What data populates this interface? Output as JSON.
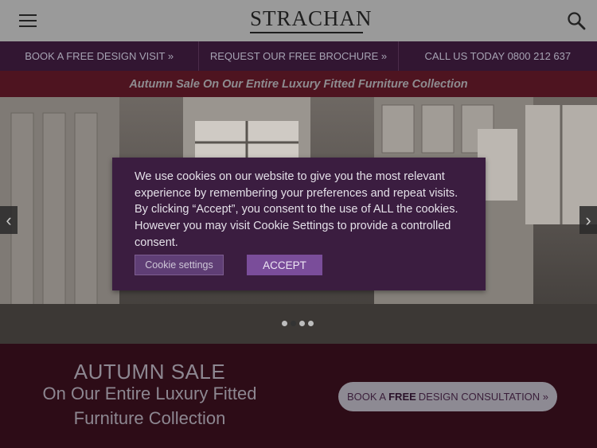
{
  "header": {
    "logo_text": "STRACHAN",
    "menu_icon": "hamburger-icon",
    "search_icon": "search-icon"
  },
  "nav": {
    "items": [
      {
        "label": "BOOK A FREE DESIGN VISIT »"
      },
      {
        "label": "REQUEST OUR FREE BROCHURE »"
      },
      {
        "label": "CALL US TODAY 0800 212 637"
      }
    ]
  },
  "promo": {
    "text": "Autumn Sale On Our Entire Luxury Fitted Furniture Collection"
  },
  "hero": {
    "prev_icon": "chevron-left-icon",
    "next_icon": "chevron-right-icon",
    "prev_glyph": "‹",
    "next_glyph": "›",
    "slides_count": 4,
    "active_slide": 2
  },
  "cookie": {
    "message": "We use cookies on our website to give you the most relevant experience by remembering your preferences and repeat visits. By clicking “Accept”, you consent to the use of ALL the cookies. However you may visit Cookie Settings to provide a controlled consent.",
    "settings_label": "Cookie settings",
    "accept_label": "ACCEPT"
  },
  "sale": {
    "title": "AUTUMN SALE",
    "subtitle_line1": "On Our Entire Luxury Fitted",
    "subtitle_line2": "Furniture Collection",
    "button_prefix": "BOOK A",
    "button_bold": "FREE",
    "button_suffix": "DESIGN CONSULTATION »"
  },
  "colors": {
    "header_bg": "#9a9a9a",
    "nav_bg": "#321632",
    "promo_bg": "#4e1420",
    "cookie_bg": "#3b1d40",
    "accept_bg": "#7a4d9a",
    "sale_bg": "#2d0c17"
  }
}
